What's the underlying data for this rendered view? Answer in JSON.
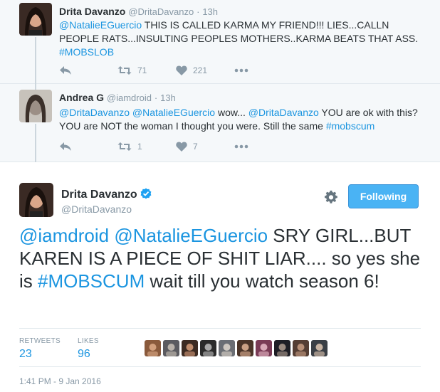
{
  "tweets": [
    {
      "name": "Drita Davanzo",
      "handle": "@DritaDavanzo",
      "dot": "·",
      "time": "13h",
      "segments": [
        {
          "t": "@NatalieEGuercio",
          "link": true
        },
        {
          "t": " THIS IS CALLED KARMA MY FRIEND!!! LIES...CALLN PEOPLE RATS...INSULTING PEOPLES MOTHERS..KARMA BEATS THAT ASS. ",
          "link": false
        },
        {
          "t": "#MOBSLOB",
          "link": true
        }
      ],
      "retweets": "71",
      "likes": "221",
      "icons": [
        "reply-icon",
        "retweet-icon",
        "like-icon",
        "more-icon"
      ]
    },
    {
      "name": "Andrea G",
      "handle": "@iamdroid",
      "dot": "·",
      "time": "13h",
      "segments": [
        {
          "t": "@DritaDavanzo",
          "link": true
        },
        {
          "t": " ",
          "link": false
        },
        {
          "t": "@NatalieEGuercio",
          "link": true
        },
        {
          "t": " wow... ",
          "link": false
        },
        {
          "t": "@DritaDavanzo",
          "link": true
        },
        {
          "t": " YOU are ok with this? YOU are NOT the woman I thought you were. Still the same ",
          "link": false
        },
        {
          "t": "#mobscum",
          "link": true
        }
      ],
      "retweets": "1",
      "likes": "7",
      "icons": [
        "reply-icon",
        "retweet-icon",
        "like-icon",
        "more-icon"
      ]
    }
  ],
  "main": {
    "name": "Drita Davanzo",
    "handle": "@DritaDavanzo",
    "follow_label": "Following",
    "segments": [
      {
        "t": "@iamdroid",
        "link": true
      },
      {
        "t": " ",
        "link": false
      },
      {
        "t": "@NatalieEGuercio",
        "link": true
      },
      {
        "t": " SRY GIRL...BUT KAREN IS A PIECE OF SHIT LIAR.... so yes she is ",
        "link": false
      },
      {
        "t": "#MOBSCUM",
        "link": true
      },
      {
        "t": " wait till you watch season 6!",
        "link": false
      }
    ],
    "retweets_label": "RETWEETS",
    "retweets": "23",
    "likes_label": "LIKES",
    "likes": "96",
    "timestamp": "1:41 PM - 9 Jan 2016",
    "liker_count_shown": 10
  },
  "colors": {
    "link": "#1b95e0",
    "muted": "#8899a6",
    "text": "#292f33",
    "follow_bg": "#4ab3f4",
    "reply_bg": "#f5f8fa",
    "verified": "#1da1f2"
  }
}
